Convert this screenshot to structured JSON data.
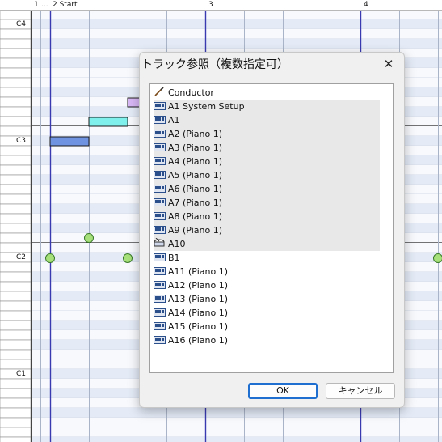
{
  "ruler": {
    "labels": [
      "1",
      "...",
      "2 Start",
      "3",
      "4"
    ]
  },
  "keyboard": {
    "labels": [
      "C4",
      "C3",
      "C2",
      "C1"
    ]
  },
  "colors": {
    "note_blue": "#6f93e0",
    "note_cyan": "#7ff0ec",
    "note_purple": "#d8b7f5",
    "velocity_dot": "#a6e07a",
    "measure_line": "#3a3ab0"
  },
  "dialog": {
    "title": "トラック参照（複数指定可）",
    "close_icon": "close-icon",
    "ok_label": "OK",
    "cancel_label": "キャンセル",
    "tracks": [
      {
        "label": "Conductor",
        "icon": "conductor-baton-icon",
        "selected": false
      },
      {
        "label": "A1 System Setup",
        "icon": "midi-track-icon",
        "selected": true
      },
      {
        "label": "A1",
        "icon": "midi-track-icon",
        "selected": true
      },
      {
        "label": "A2 (Piano 1)",
        "icon": "midi-track-icon",
        "selected": true
      },
      {
        "label": "A3 (Piano 1)",
        "icon": "midi-track-icon",
        "selected": true
      },
      {
        "label": "A4 (Piano 1)",
        "icon": "midi-track-icon",
        "selected": true
      },
      {
        "label": "A5 (Piano 1)",
        "icon": "midi-track-icon",
        "selected": true
      },
      {
        "label": "A6 (Piano 1)",
        "icon": "midi-track-icon",
        "selected": true
      },
      {
        "label": "A7 (Piano 1)",
        "icon": "midi-track-icon",
        "selected": true
      },
      {
        "label": "A8 (Piano 1)",
        "icon": "midi-track-icon",
        "selected": true
      },
      {
        "label": "A9 (Piano 1)",
        "icon": "midi-track-icon",
        "selected": true
      },
      {
        "label": "A10",
        "icon": "drum-track-icon",
        "selected": true
      },
      {
        "label": "B1",
        "icon": "midi-track-icon",
        "selected": false
      },
      {
        "label": "A11 (Piano 1)",
        "icon": "midi-track-icon",
        "selected": false
      },
      {
        "label": "A12 (Piano 1)",
        "icon": "midi-track-icon",
        "selected": false
      },
      {
        "label": "A13 (Piano 1)",
        "icon": "midi-track-icon",
        "selected": false
      },
      {
        "label": "A14 (Piano 1)",
        "icon": "midi-track-icon",
        "selected": false
      },
      {
        "label": "A15 (Piano 1)",
        "icon": "midi-track-icon",
        "selected": false
      },
      {
        "label": "A16 (Piano 1)",
        "icon": "midi-track-icon",
        "selected": false
      }
    ]
  }
}
